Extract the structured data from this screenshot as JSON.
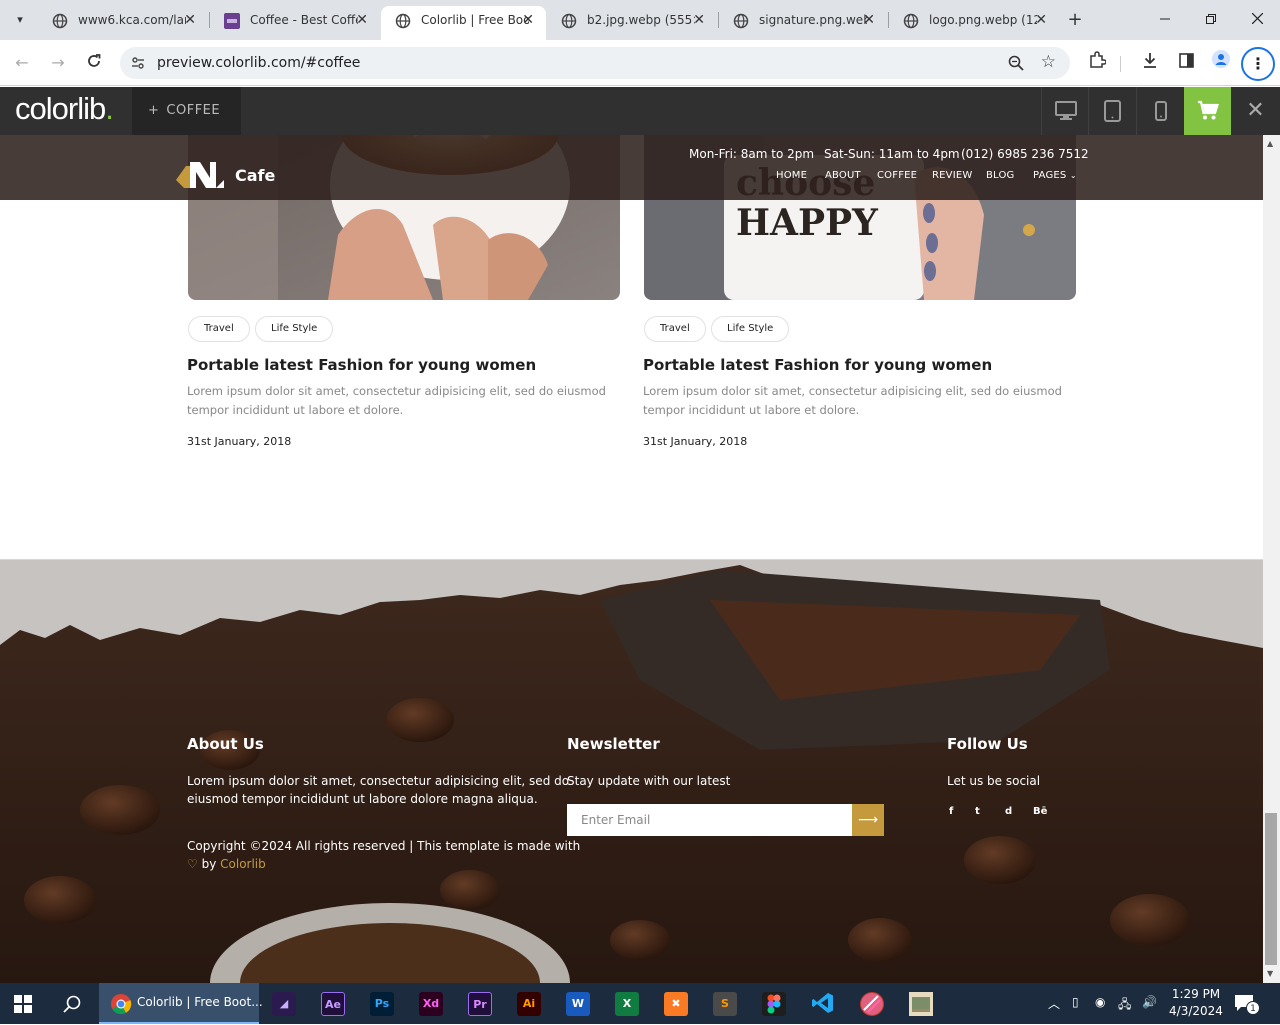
{
  "browser": {
    "tabs": [
      {
        "title": "www6.kca.com/lan",
        "close": "✕"
      },
      {
        "title": "Coffee - Best Coffe",
        "close": "✕"
      },
      {
        "title": "Colorlib | Free Boo",
        "close": "✕",
        "active": true
      },
      {
        "title": "b2.jpg.webp (555×",
        "close": "✕"
      },
      {
        "title": "signature.png.web",
        "close": "✕"
      },
      {
        "title": "logo.png.webp (12",
        "close": "✕"
      }
    ],
    "new_tab": "+",
    "url": "preview.colorlib.com/#coffee"
  },
  "demo_bar": {
    "logo": "colorlib",
    "logo_dot": ".",
    "theme_tab": "COFFEE",
    "close": "✕"
  },
  "site": {
    "name": "Cafe",
    "hours_weekday": "Mon-Fri: 8am to 2pm",
    "hours_weekend": "Sat-Sun: 11am to 4pm",
    "phone": "(012) 6985 236 7512",
    "nav": [
      "HOME",
      "ABOUT",
      "COFFEE",
      "REVIEW",
      "BLOG",
      "PAGES"
    ]
  },
  "posts": [
    {
      "tags": [
        "Travel",
        "Life Style"
      ],
      "title": "Portable latest Fashion for young women",
      "desc_1": "Lorem ipsum dolor sit amet, consectetur adipisicing elit, sed do eiusmod",
      "desc_2": "tempor incididunt ut labore et dolore.",
      "date": "31st January, 2018",
      "image_text": ""
    },
    {
      "tags": [
        "Travel",
        "Life Style"
      ],
      "title": "Portable latest Fashion for young women",
      "desc_1": "Lorem ipsum dolor sit amet, consectetur adipisicing elit, sed do eiusmod",
      "desc_2": "tempor incididunt ut labore et dolore.",
      "date": "31st January, 2018",
      "image_text": "choose HAPPY"
    }
  ],
  "footer": {
    "about_title": "About Us",
    "about_text_1": "Lorem ipsum dolor sit amet, consectetur adipisicing elit, sed do",
    "about_text_2": "eiusmod tempor incididunt ut labore dolore magna aliqua.",
    "copyright_1": "Copyright ©2024 All rights reserved | This template is made with",
    "copyright_by": "by",
    "copyright_link": "Colorlib",
    "newsletter_title": "Newsletter",
    "newsletter_text": "Stay update with our latest",
    "email_placeholder": "Enter Email",
    "follow_title": "Follow Us",
    "follow_text": "Let us be social",
    "social": [
      "f",
      "t",
      "d",
      "Bē"
    ]
  },
  "taskbar": {
    "active_app": "Colorlib | Free Boot...",
    "apps": [
      "Ae",
      "Ps",
      "Xd",
      "Pr",
      "Ai",
      "W",
      "X"
    ],
    "time": "1:29 PM",
    "date": "4/3/2024",
    "notifications": "1"
  },
  "colors": {
    "accent": "#c49a3c",
    "header": "#2f211e",
    "demo_cart": "#82c341"
  }
}
